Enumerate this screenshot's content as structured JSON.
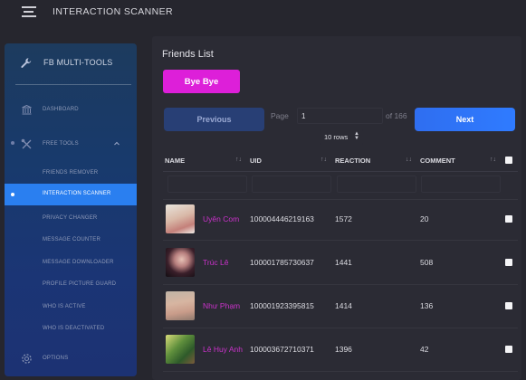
{
  "app": {
    "title": "INTERACTION SCANNER"
  },
  "sidebar": {
    "brand": "FB MULTI-TOOLS",
    "items": [
      {
        "label": "DASHBOARD"
      },
      {
        "label": "FREE TOOLS"
      },
      {
        "label": "FRIENDS REMOVER"
      },
      {
        "label": "INTERACTION SCANNER"
      },
      {
        "label": "PRIVACY CHANGER"
      },
      {
        "label": "MESSAGE COUNTER"
      },
      {
        "label": "MESSAGE DOWNLOADER"
      },
      {
        "label": "PROFILE PICTURE GUARD"
      },
      {
        "label": "WHO IS ACTIVE"
      },
      {
        "label": "WHO IS DEACTIVATED"
      },
      {
        "label": "OPTIONS"
      }
    ]
  },
  "main": {
    "title": "Friends List",
    "bye_label": "Bye Bye",
    "prev_label": "Previous",
    "next_label": "Next",
    "page_label": "Page",
    "page_value": "1",
    "of_label": "of 166",
    "rows_label": "10 rows",
    "columns": [
      "NAME",
      "UID",
      "REACTION",
      "COMMENT"
    ],
    "rows": [
      {
        "name": "Uyên Com",
        "uid": "100004446219163",
        "reaction": "1572",
        "comment": "20"
      },
      {
        "name": "Trúc Lê",
        "uid": "100001785730637",
        "reaction": "1441",
        "comment": "508"
      },
      {
        "name": "Như Phạm",
        "uid": "100001923395815",
        "reaction": "1414",
        "comment": "136"
      },
      {
        "name": "Lê Huy Anh",
        "uid": "100003672710371",
        "reaction": "1396",
        "comment": "42"
      }
    ]
  },
  "colors": {
    "accent": "#2a7ff0",
    "bye": "#dd1fd9",
    "name": "#c932c9"
  }
}
